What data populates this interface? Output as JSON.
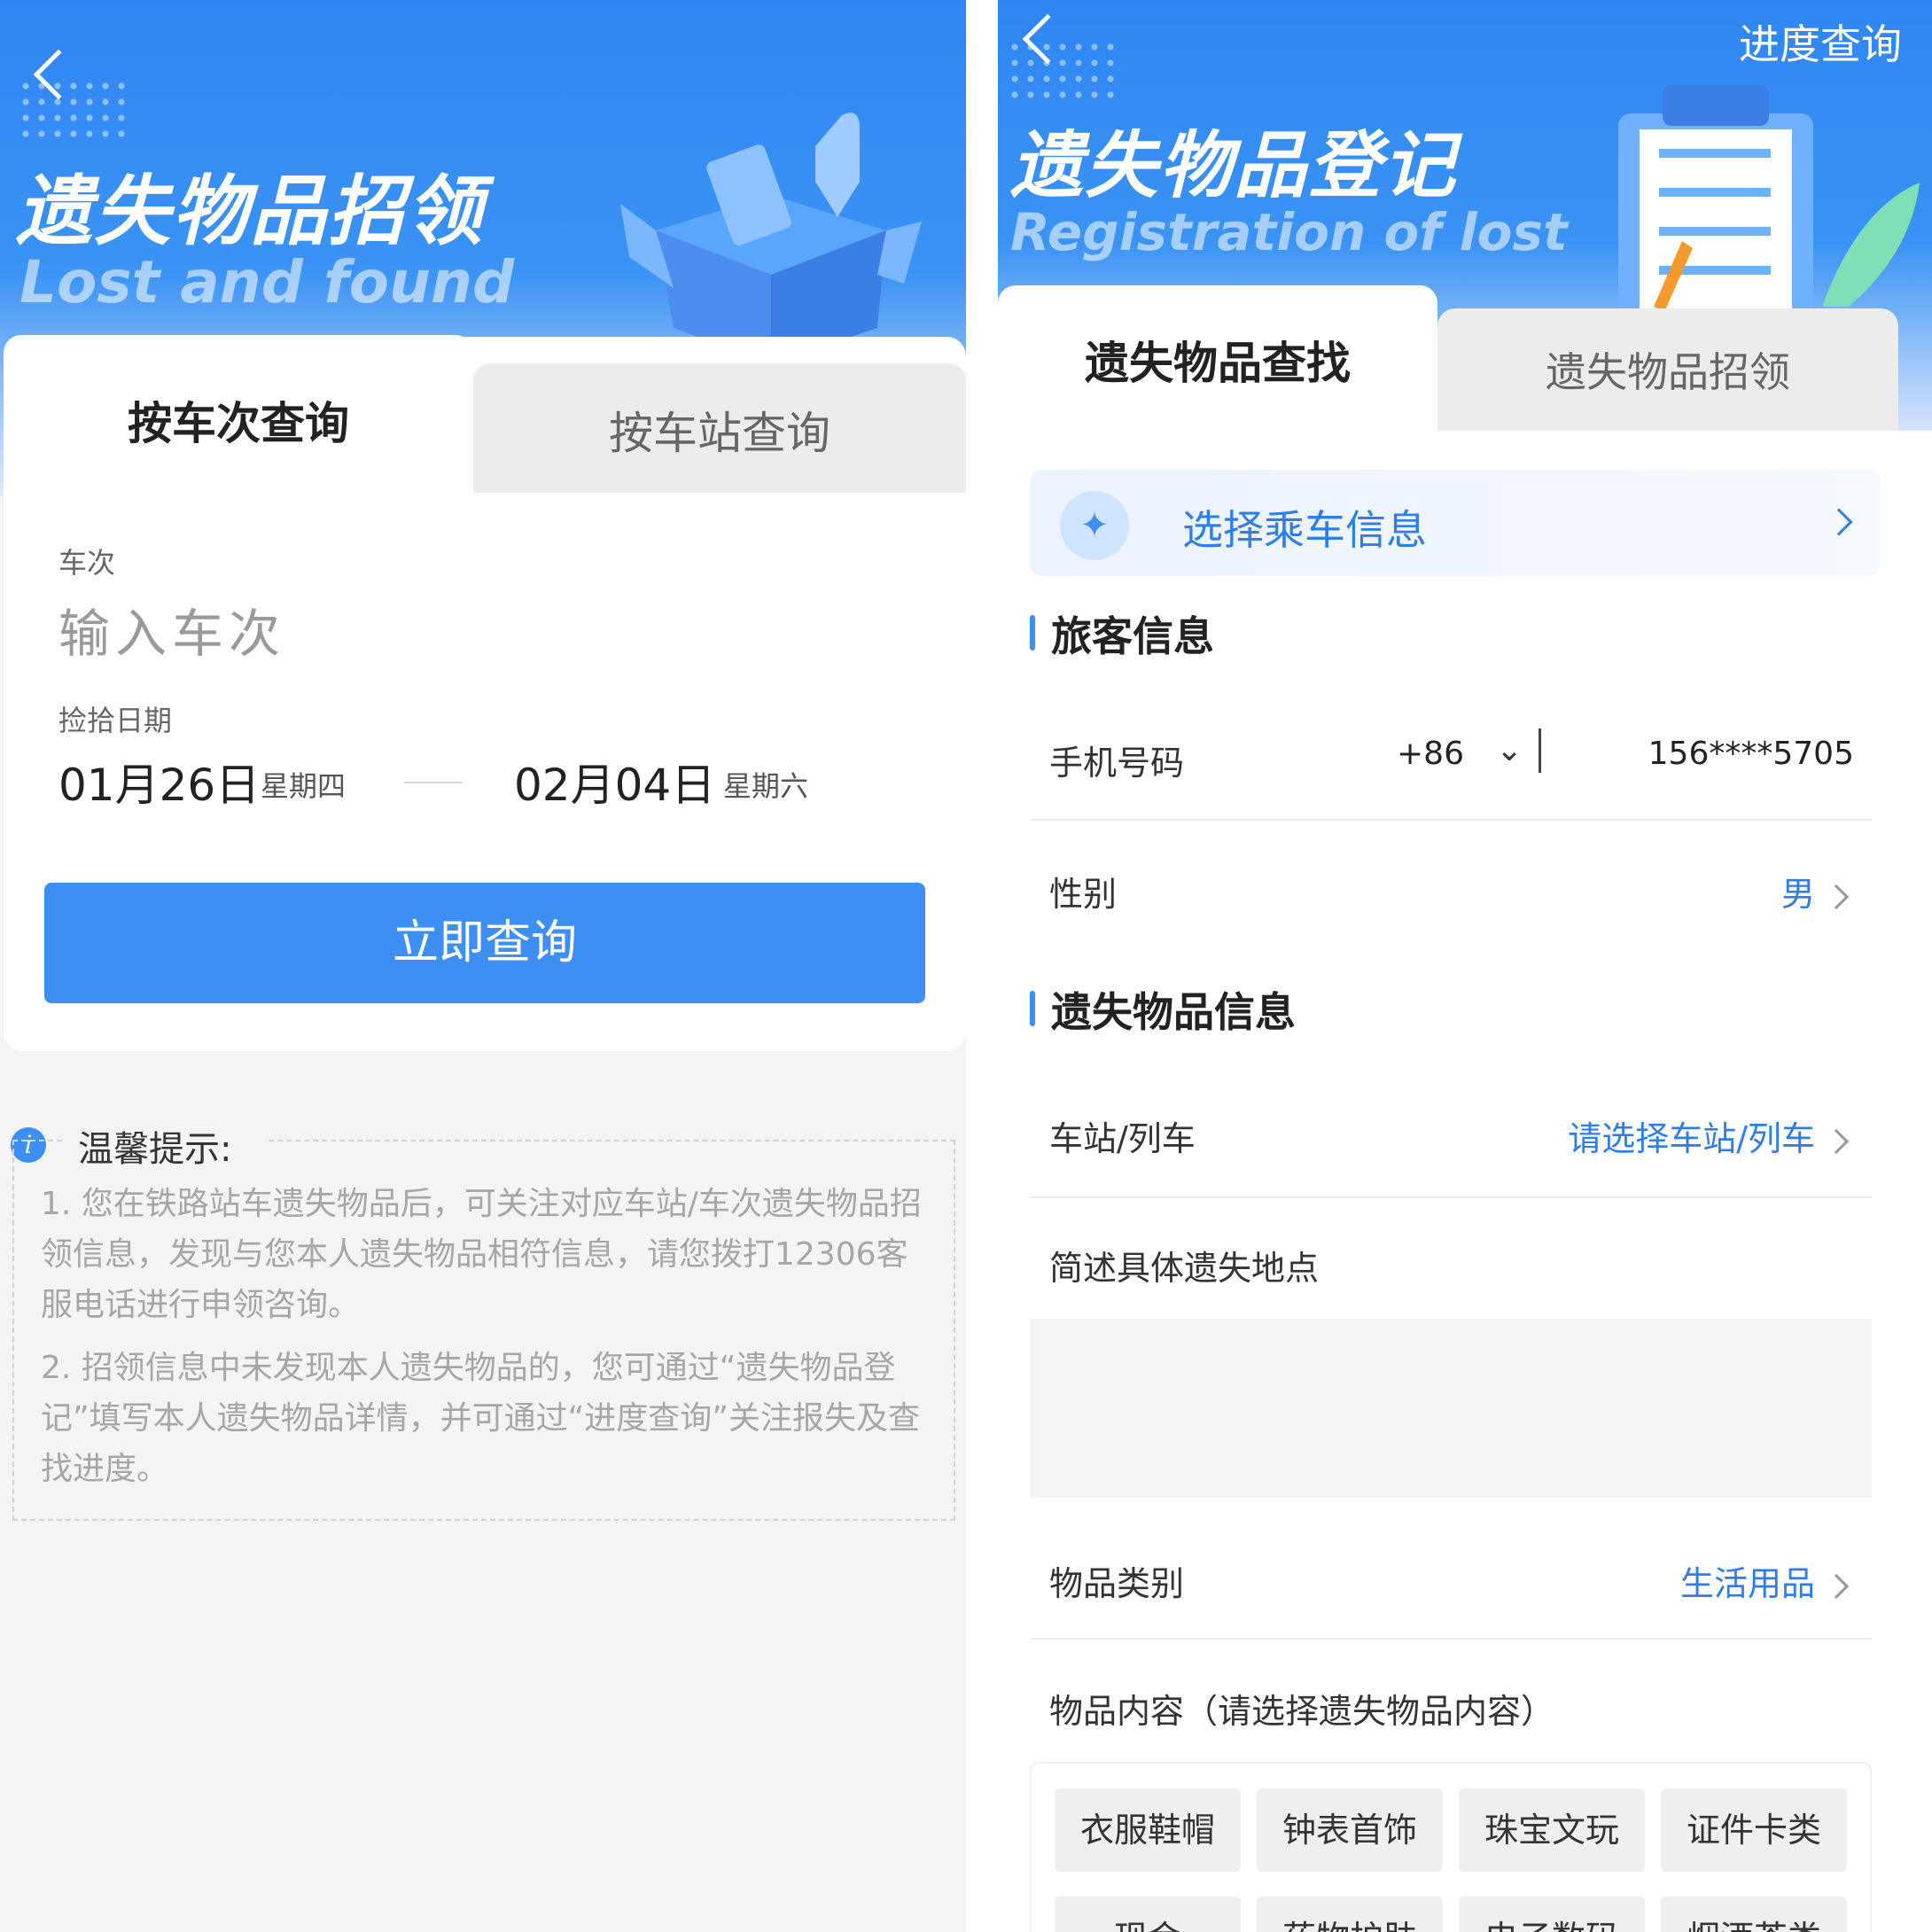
{
  "left": {
    "hero_title": "遗失物品招领",
    "hero_subtitle": "Lost and found",
    "tabs": [
      "按车次查询",
      "按车站查询"
    ],
    "train_label": "车次",
    "train_placeholder": "输入车次",
    "date_label": "捡拾日期",
    "date_from": "01月26日",
    "date_from_weekday": "星期四",
    "date_to": "02月04日",
    "date_to_weekday": "星期六",
    "search_button": "立即查询",
    "notice_title": "温馨提示:",
    "notice_items": [
      "1. 您在铁路站车遗失物品后，可关注对应车站/车次遗失物品招领信息，发现与您本人遗失物品相符信息，请您拨打12306客服电话进行申领咨询。",
      "2. 招领信息中未发现本人遗失物品的，您可通过“遗失物品登记”填写本人遗失物品详情，并可通过“进度查询”关注报失及查找进度。"
    ]
  },
  "right": {
    "progress_link": "进度查询",
    "hero_title": "遗失物品登记",
    "hero_subtitle": "Registration of lost",
    "tabs": [
      "遗失物品查找",
      "遗失物品招领"
    ],
    "select_trip": "选择乘车信息",
    "section_passenger": "旅客信息",
    "phone_label": "手机号码",
    "phone_code": "+86",
    "phone_value": "156****5705",
    "gender_label": "性别",
    "gender_value": "男",
    "section_item": "遗失物品信息",
    "station_label": "车站/列车",
    "station_value": "请选择车站/列车",
    "place_label": "简述具体遗失地点",
    "category_label": "物品类别",
    "category_value": "生活用品",
    "content_label": "物品内容（请选择遗失物品内容）",
    "chips": [
      "衣服鞋帽",
      "钟表首饰",
      "珠宝文玩",
      "证件卡类",
      "现金",
      "药物护肤",
      "电子数码",
      "烟酒茶类"
    ]
  },
  "colors": {
    "brand_blue": "#3d8ff3",
    "link_blue": "#2f7ee8",
    "hero_blue": "#2f86f2"
  }
}
